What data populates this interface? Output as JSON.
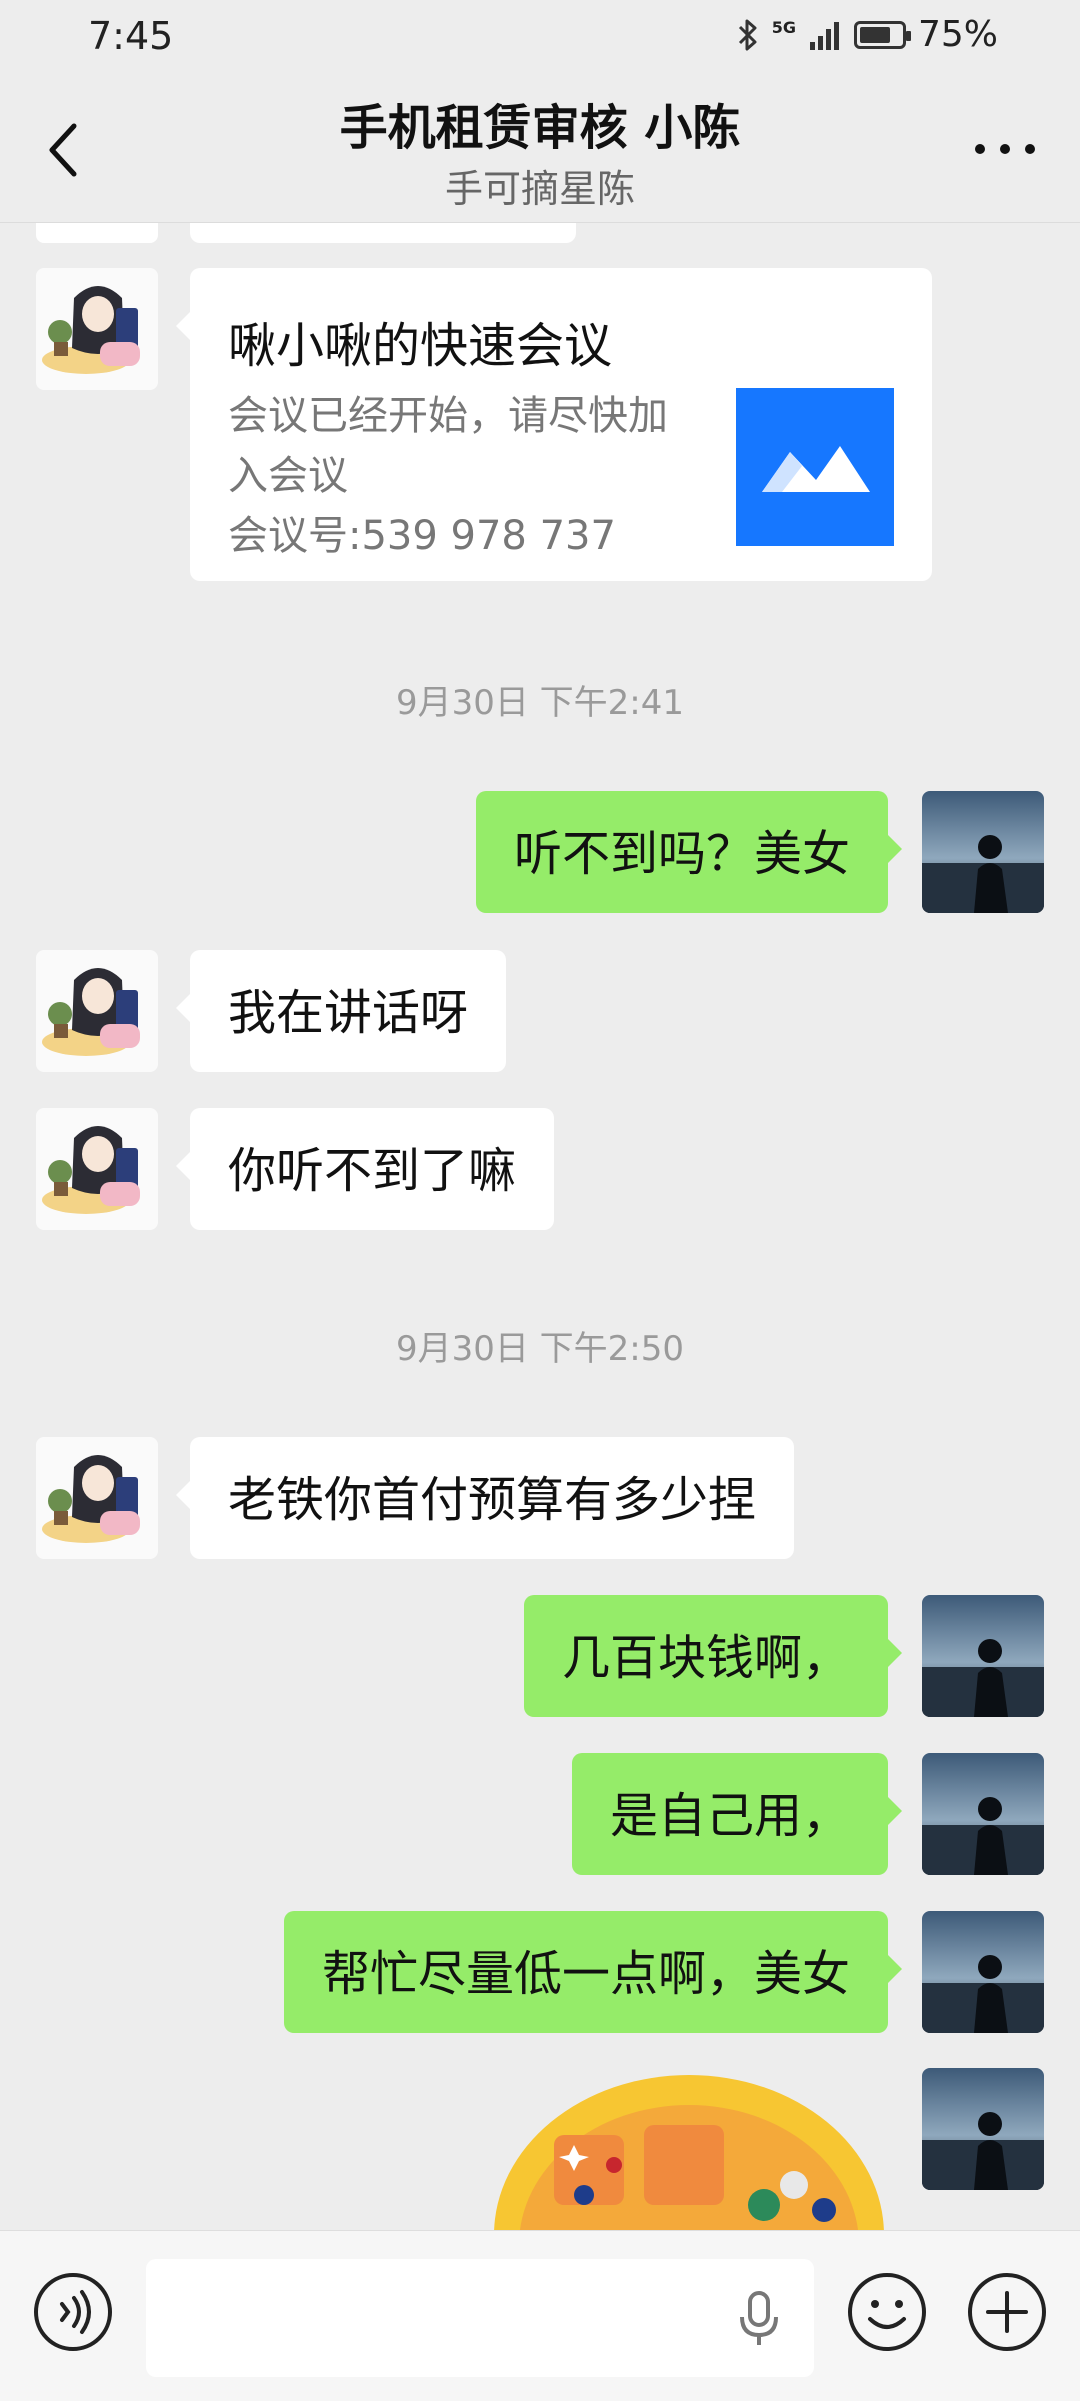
{
  "status_bar": {
    "time": "7:45",
    "network": "5G",
    "battery": "75%",
    "battery_level": 0.75
  },
  "header": {
    "title": "手机租赁审核 小陈",
    "subtitle": "手可摘星陈"
  },
  "messages": {
    "card": {
      "title": "啾小啾的快速会议",
      "line1": "会议已经开始，请尽快加",
      "line2": "入会议",
      "line3": "会议号:539 978 737"
    },
    "ts1": "9月30日 下午2:41",
    "m1": "听不到吗？美女",
    "m2": "我在讲话呀",
    "m3": "你听不到了嘛",
    "ts2": "9月30日 下午2:50",
    "m4": "老铁你首付预算有多少捏",
    "m5": "几百块钱啊，",
    "m6": "是自己用，",
    "m7": "帮忙尽量低一点啊，美女"
  },
  "colors": {
    "background": "#ededed",
    "outgoing_bubble": "#95ec69",
    "incoming_bubble": "#ffffff",
    "meeting_logo": "#1677ff"
  }
}
